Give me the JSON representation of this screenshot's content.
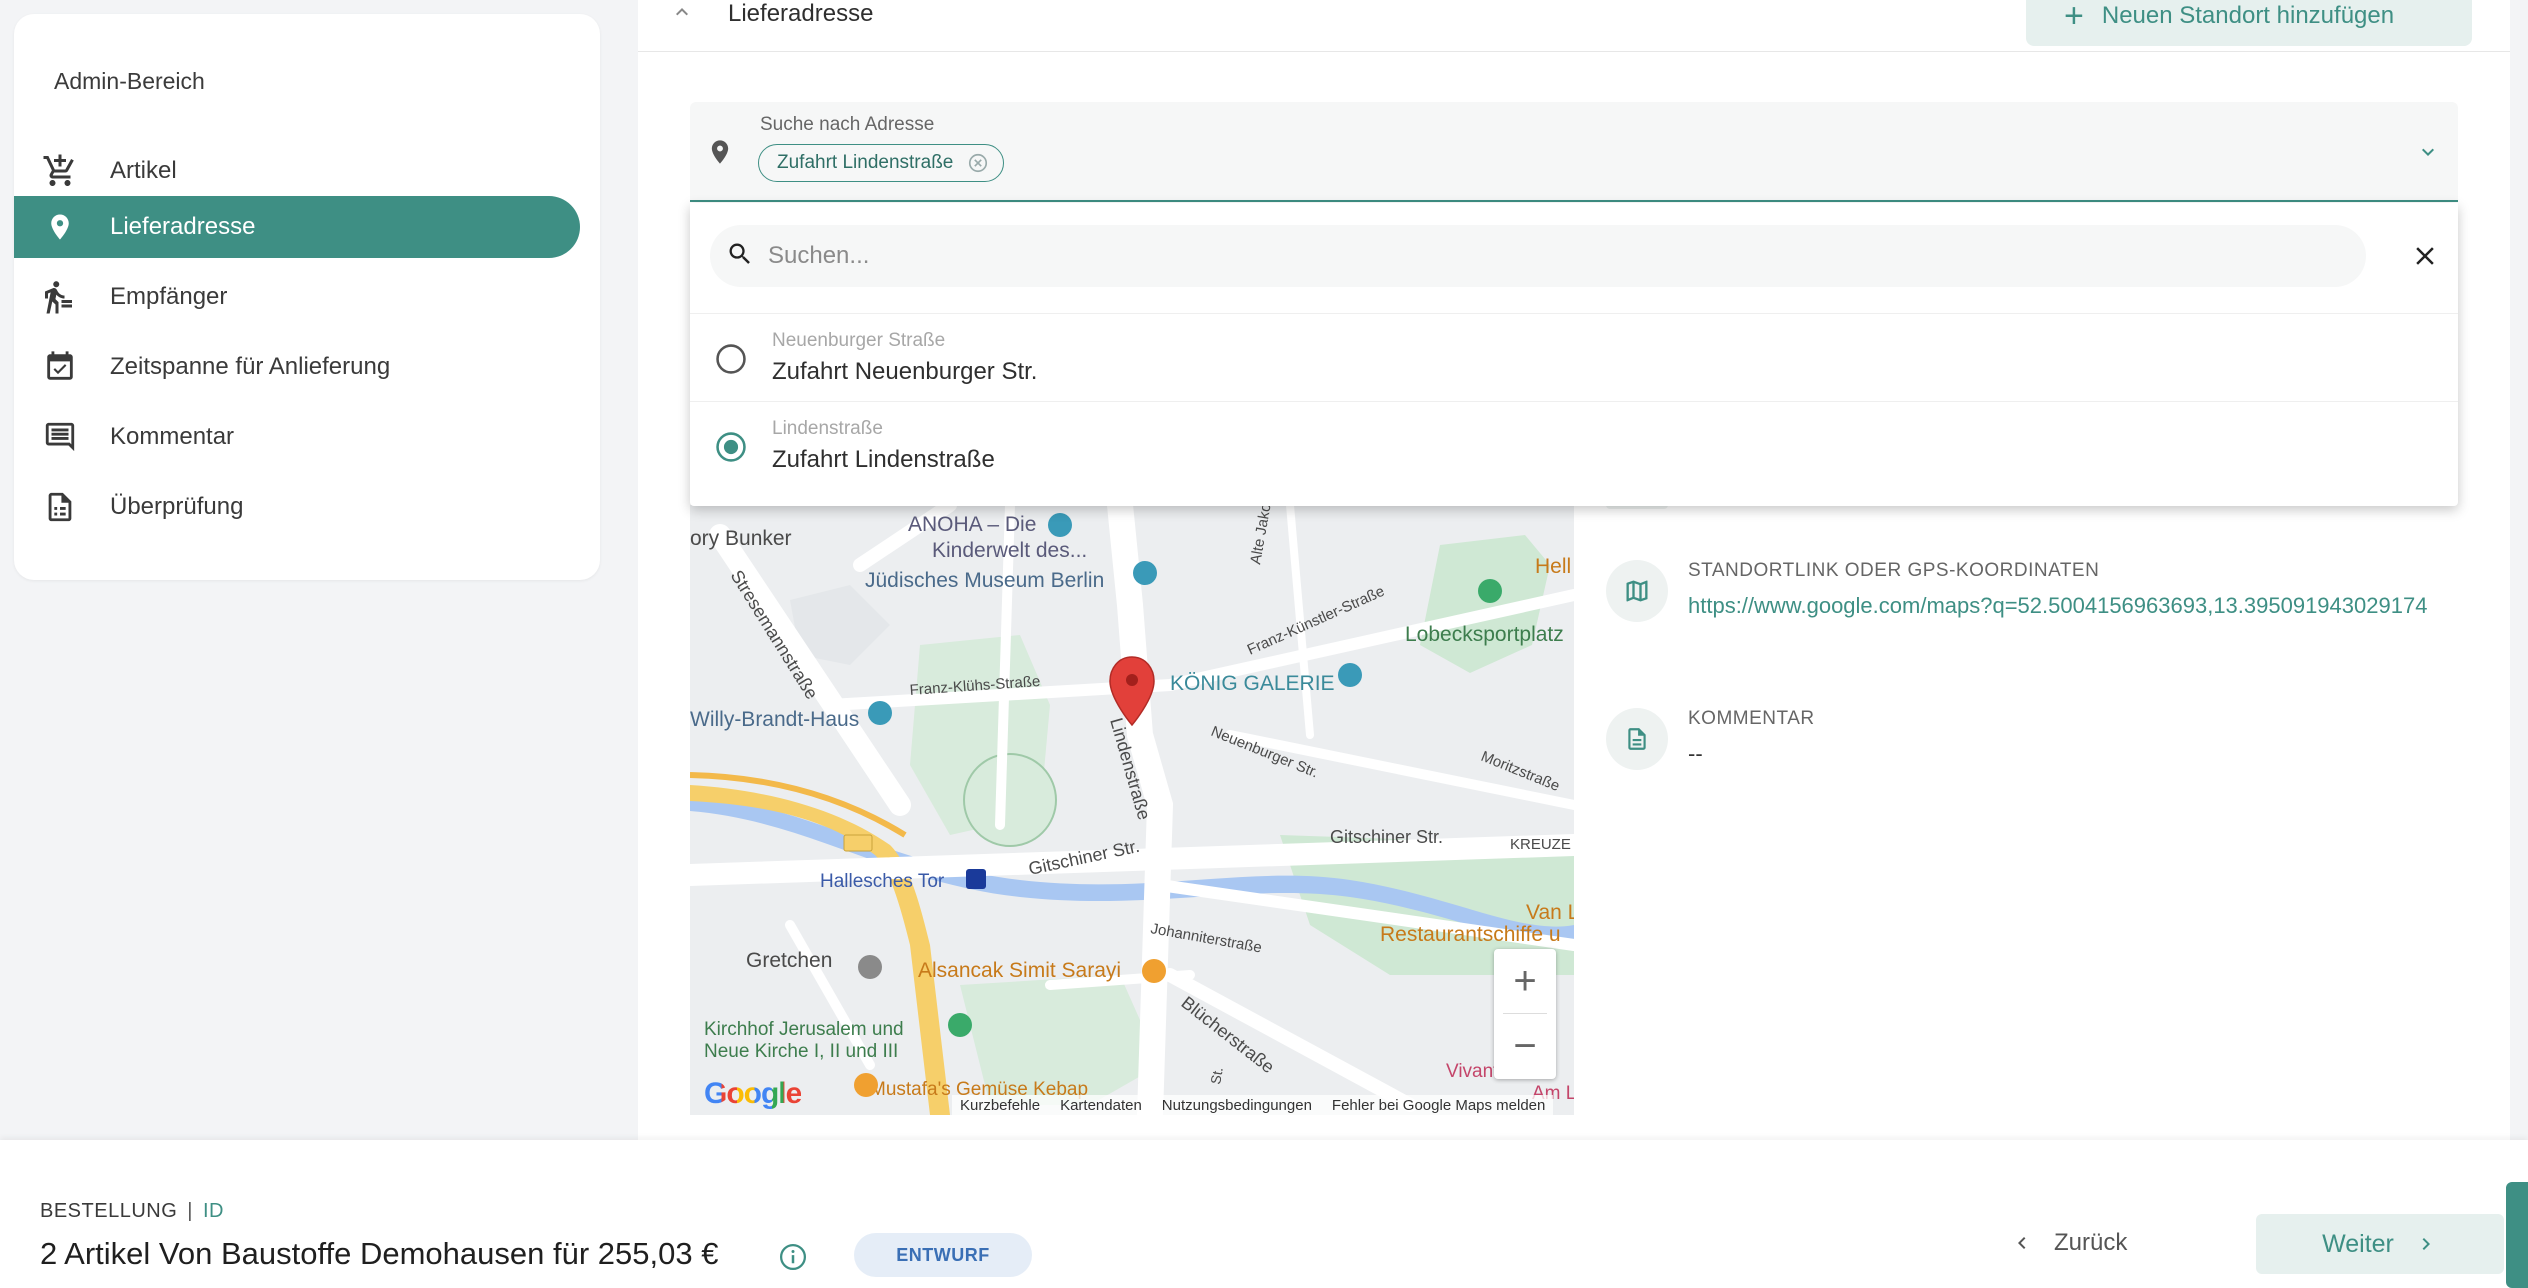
{
  "sidebar": {
    "title": "Admin-Bereich",
    "items": [
      {
        "label": "Artikel",
        "icon": "cart-plus-icon"
      },
      {
        "label": "Lieferadresse",
        "icon": "map-pin-icon",
        "active": true
      },
      {
        "label": "Empfänger",
        "icon": "person-walking-icon"
      },
      {
        "label": "Zeitspanne für Anlieferung",
        "icon": "calendar-check-icon"
      },
      {
        "label": "Kommentar",
        "icon": "comment-icon"
      },
      {
        "label": "Überprüfung",
        "icon": "document-check-icon"
      }
    ]
  },
  "section": {
    "title": "Lieferadresse",
    "add_location_label": "Neuen Standort hinzufügen"
  },
  "address_field": {
    "label": "Suche nach Adresse",
    "chip": "Zufahrt Lindenstraße"
  },
  "dropdown": {
    "search_placeholder": "Suchen...",
    "options": [
      {
        "sub": "Neuenburger Straße",
        "main": "Zufahrt Neuenburger Str.",
        "selected": false
      },
      {
        "sub": "Lindenstraße",
        "main": "Zufahrt Lindenstraße",
        "selected": true
      }
    ]
  },
  "map": {
    "labels": {
      "bunker": "ory Bunker",
      "anoha": "ANOHA – Die",
      "anoha2": "Kinderwelt des...",
      "museum": "Jüdisches Museum Berlin",
      "alte_jakob": "Alte Jakobst",
      "stresemann": "Stresemannstraße",
      "franz_kluehs": "Franz-Klühs-Straße",
      "franz_kuenstler": "Franz-Künstler-Straße",
      "lobeck": "Lobecksportplatz",
      "hell": "Hell",
      "koenig": "KÖNIG GALERIE",
      "willy": "Willy-Brandt-Haus",
      "linden": "Lindenstraße",
      "neuenburger": "Neuenburger Str.",
      "moritz": "Moritzstraße",
      "gitschiner1": "Gitschiner Str.",
      "gitschiner2": "Gitschiner Str.",
      "kreuz": "KREUZE",
      "route": "96",
      "hallesches": "Hallesches Tor",
      "u": "U",
      "johanniter": "Johanniterstraße",
      "restaurant": "Restaurantschiffe u",
      "van": "Van L",
      "gretchen": "Gretchen",
      "alsancak": "Alsancak Simit Sarayi",
      "kirchhof1": "Kirchhof Jerusalem und",
      "kirchhof2": "Neue Kirche I, II und III",
      "bluecher": "Blücherstraße",
      "mustafa": "Mustafa's Gemüse Kebap",
      "vivantes": "Vivantes Klin",
      "am": "Am L",
      "st": "St."
    },
    "footer": [
      "Kurzbefehle",
      "Kartendaten",
      "Nutzungsbedingungen",
      "Fehler bei Google Maps melden"
    ],
    "logo": "Google",
    "zoom_in": "+",
    "zoom_out": "−"
  },
  "details": {
    "link_label": "STANDORTLINK ODER GPS-KOORDINATEN",
    "link_value": "https://www.google.com/maps?q=52.5004156963693,13.395091943029174",
    "comment_label": "KOMMENTAR",
    "comment_value": "--"
  },
  "footer": {
    "order_label": "BESTELLUNG",
    "separator": "|",
    "order_id": "ID",
    "title": "2 Artikel Von Baustoffe Demohausen für 255,03 €",
    "status": "ENTWURF",
    "back_label": "Zurück",
    "next_label": "Weiter"
  },
  "colors": {
    "accent": "#3e8f84",
    "accent_light": "#e6f0ee",
    "badge_bg": "#e5edf7",
    "badge_text": "#3a6fb5"
  }
}
